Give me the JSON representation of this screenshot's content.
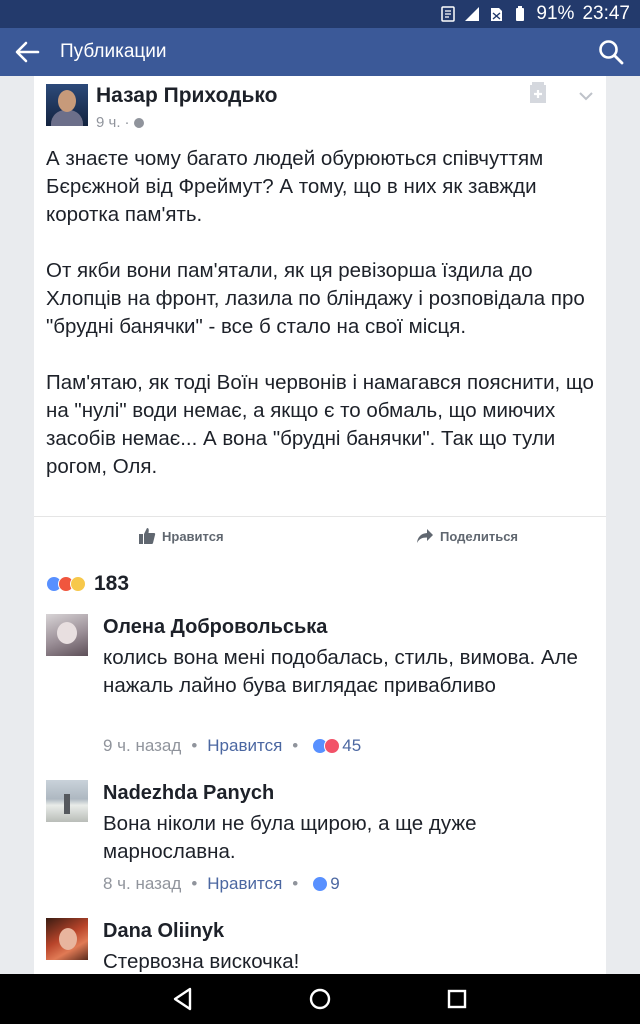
{
  "status_bar": {
    "battery": "91%",
    "time": "23:47"
  },
  "app_bar": {
    "title": "Публикации"
  },
  "post": {
    "author": "Назар Приходько",
    "time": "9 ч.",
    "paragraphs": [
      "А знаєте чому багато людей обурюються співчуттям Бєрєжной від Фреймут? А тому, що в них як завжди коротка пам'ять.",
      "От якби вони пам'ятали, як ця ревізорша їздила до Хлопців на фронт, лазила по бліндажу і розповідала про \"брудні банячки\" - все б стало на свої місця.",
      "Пам'ятаю, як тоді Воїн червонів і намагався пояснити, що на \"нулі\" води немає, а якщо є то обмаль, що миючих засобів немає... А вона \"брудні банячки\". Так що тули рогом, Оля."
    ],
    "like_label": "Нравится",
    "share_label": "Поделиться"
  },
  "reactions": {
    "total": "183"
  },
  "comments": [
    {
      "name": "Олена Добровольська",
      "text": "колись вона мені подобалась, стиль, вимова. Але нажаль лайно бува виглядає привабливо",
      "time": "9 ч. назад",
      "like_label": "Нравится",
      "count": "45"
    },
    {
      "name": "Nadezhda Panych",
      "text": "Вона ніколи не була щирою, а ще дуже марнославна.",
      "time": "8 ч. назад",
      "like_label": "Нравится",
      "count": "9"
    },
    {
      "name": "Dana Oliinyk",
      "text": "Стервозна вискочка!"
    }
  ]
}
